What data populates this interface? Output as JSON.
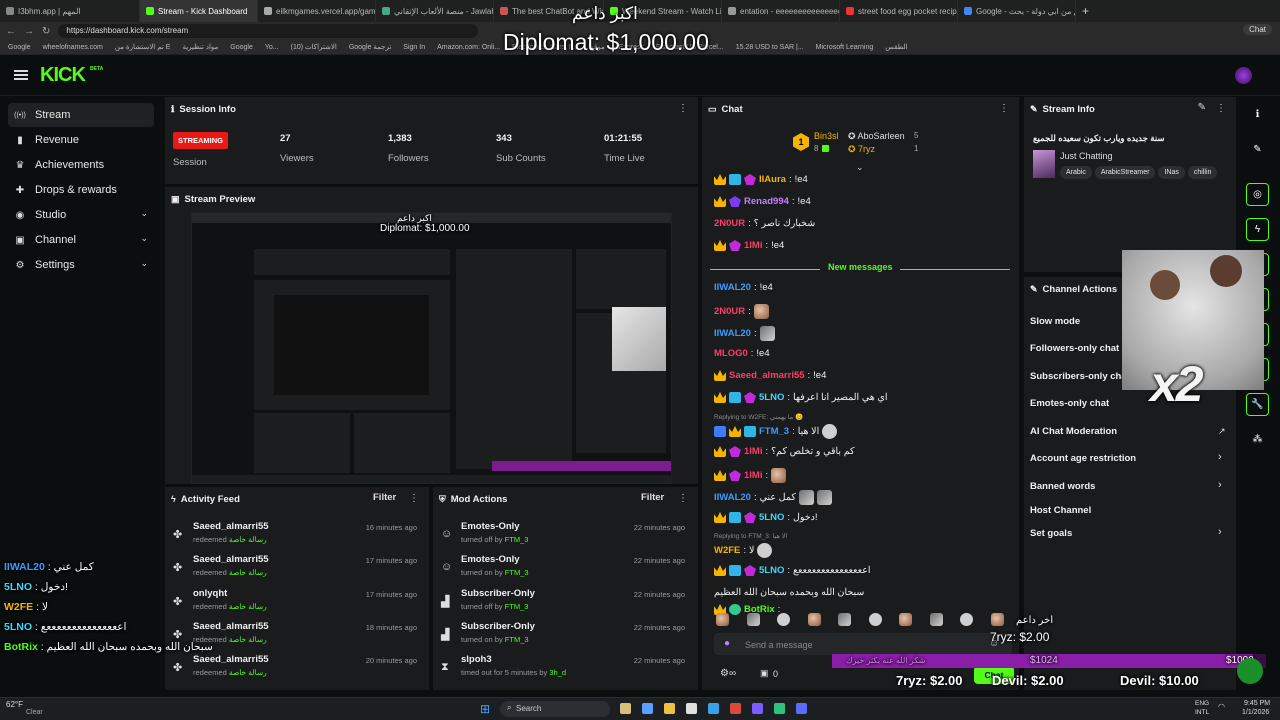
{
  "browser": {
    "tabs": [
      "I3bhm.app | المهم",
      "Stream - Kick Dashboard",
      "eilkmgames.vercel.app/games/wh",
      "منصة الألعاب الإتقاني - Jawlah | جولة",
      "The best ChatBot and Widgets fo",
      "Weekend Stream - Watch Live",
      "entation - eeeeeeeeeeeeeeeeeee",
      "street food egg pocket recipe بيض",
      "Google - المطبق من ابي دولة - بحث"
    ],
    "active_tab": 1,
    "url": "https://dashboard.kick.com/stream",
    "bookmarks": [
      "Google",
      "wheelofnames.com",
      "تم الاستشارة من E",
      "مواد تنظيرية",
      "Google",
      "Yo...",
      "(10) الاشتراكات",
      "Google ترجمة",
      "Sign In",
      "Amazon.com: Onli...",
      "Electronics, Cars, F...",
      "موقع - AliExpress",
      "Fishofast US Parcel...",
      "15.28 USD to SAR |...",
      "Microsoft Learning",
      "الطقس"
    ],
    "chat_button": "Chat"
  },
  "app": {
    "logo": "KICK",
    "beta": "BETA"
  },
  "nav": {
    "items": [
      {
        "label": "Stream",
        "icon": "stream-icon"
      },
      {
        "label": "Revenue",
        "icon": "revenue-icon"
      },
      {
        "label": "Achievements",
        "icon": "trophy-icon"
      },
      {
        "label": "Drops & rewards",
        "icon": "gift-icon"
      },
      {
        "label": "Studio",
        "icon": "studio-icon"
      },
      {
        "label": "Channel",
        "icon": "channel-icon"
      },
      {
        "label": "Settings",
        "icon": "gear-icon"
      }
    ]
  },
  "session": {
    "title": "Session Info",
    "badge": "STREAMING",
    "session_label": "Session",
    "viewers": "27",
    "viewers_label": "Viewers",
    "followers": "1,383",
    "followers_label": "Followers",
    "subs": "343",
    "subs_label": "Sub Counts",
    "time": "01:21:55",
    "time_label": "Time Live"
  },
  "preview": {
    "title": "Stream Preview",
    "overlay_arabic": "اكبر داعم",
    "overlay_diplomat": "Diplomat: $1,000.00"
  },
  "activity": {
    "title": "Activity Feed",
    "filter": "Filter",
    "rows": [
      {
        "name": "Saeed_almarri55",
        "action": "redeemed",
        "reward": "رسالة خاصة",
        "time": "16 minutes ago"
      },
      {
        "name": "Saeed_almarri55",
        "action": "redeemed",
        "reward": "رسالة خاصة",
        "time": "17 minutes ago"
      },
      {
        "name": "onlyqht",
        "action": "redeemed",
        "reward": "رسالة خاصة",
        "time": "17 minutes ago"
      },
      {
        "name": "Saeed_almarri55",
        "action": "redeemed",
        "reward": "رسالة خاصة",
        "time": "18 minutes ago"
      },
      {
        "name": "Saeed_almarri55",
        "action": "redeemed",
        "reward": "رسالة خاصة",
        "time": "20 minutes ago"
      }
    ]
  },
  "mod": {
    "title": "Mod Actions",
    "filter": "Filter",
    "rows": [
      {
        "name": "Emotes-Only",
        "action": "turned off by",
        "by": "FTM_3",
        "time": "22 minutes ago"
      },
      {
        "name": "Emotes-Only",
        "action": "turned on by",
        "by": "FTM_3",
        "time": "22 minutes ago"
      },
      {
        "name": "Subscriber-Only",
        "action": "turned off by",
        "by": "FTM_3",
        "time": "22 minutes ago"
      },
      {
        "name": "Subscriber-Only",
        "action": "turned on by",
        "by": "FTM_3",
        "time": "22 minutes ago"
      },
      {
        "name": "slpoh3",
        "action": "timed out for 5 minutes by",
        "by": "3h_d",
        "time": "22 minutes ago"
      }
    ]
  },
  "chat": {
    "title": "Chat",
    "leaders": [
      {
        "rank": "1",
        "name": "Bin3sl",
        "count": "8"
      },
      {
        "rank": "",
        "name": "AboSarleen",
        "count": "5"
      },
      {
        "rank": "",
        "name": "7ryz",
        "count": "1"
      }
    ],
    "new_messages": "New messages",
    "messages": [
      {
        "user": "IIAura",
        "color": "#f5b400",
        "text": "!e4"
      },
      {
        "user": "Renad994",
        "color": "#c77dff",
        "text": "!e4"
      },
      {
        "user": "2N0UR",
        "color": "#ff3d6b",
        "text": "شخبارك ناصر ؟"
      },
      {
        "user": "1IMi",
        "color": "#ff3d6b",
        "text": "!e4"
      },
      {
        "user": "IIWAL20",
        "color": "#3d9bff",
        "text": "!e4"
      },
      {
        "user": "2N0UR",
        "color": "#ff3d6b",
        "text": ""
      },
      {
        "user": "IIWAL20",
        "color": "#3d9bff",
        "text": ""
      },
      {
        "user": "MLOG0",
        "color": "#ff3d6b",
        "text": "!e4"
      },
      {
        "user": "Saeed_almarri55",
        "color": "#ff3d6b",
        "text": "!e4"
      },
      {
        "user": "5LNO",
        "color": "#3dd7ff",
        "text": "اي هي المصير انا اعرفها"
      },
      {
        "user": "FTM_3",
        "color": "#3d9bff",
        "text": "الا هيا"
      },
      {
        "user": "1IMi",
        "color": "#ff3d6b",
        "text": "كم باقي و تخلص كم؟"
      },
      {
        "user": "1IMi",
        "color": "#ff3d6b",
        "text": ""
      },
      {
        "user": "IIWAL20",
        "color": "#3d9bff",
        "text": "كمل عني"
      },
      {
        "user": "5LNO",
        "color": "#3dd7ff",
        "text": "دخول!"
      },
      {
        "user": "W2FE",
        "color": "#f5b400",
        "text": "لا"
      },
      {
        "user": "5LNO",
        "color": "#3dd7ff",
        "text": "اعععععععععععععععع"
      },
      {
        "user": "",
        "color": "#f0f0f0",
        "text": "سبحان الله وبحمده سبحان الله العظيم"
      },
      {
        "user": "BotRix",
        "color": "#53fc18",
        "text": ""
      }
    ],
    "reply1": "Replying to W2FE: ما يهمني 😊",
    "reply2": "Replying to FTM_3: الا هيا",
    "placeholder": "Send a message",
    "count": "0",
    "send_label": "Chat"
  },
  "streaminfo": {
    "title": "Stream Info",
    "stream_title": "سنة جديده ويارب تكون سعيده للجميع",
    "category": "Just Chatting",
    "tags": [
      "Arabic",
      "ArabicStreamer",
      "INas",
      "chillin"
    ]
  },
  "actions": {
    "title": "Channel Actions",
    "items": [
      {
        "label": "Slow mode",
        "chev": false
      },
      {
        "label": "Followers-only chat",
        "chev": false
      },
      {
        "label": "Subscribers-only chat",
        "chev": false
      },
      {
        "label": "Emotes-only chat",
        "chev": false
      },
      {
        "label": "AI Chat Moderation",
        "chev": false
      },
      {
        "label": "Account age restriction",
        "chev": true
      },
      {
        "label": "Banned words",
        "chev": true
      },
      {
        "label": "Host Channel",
        "chev": false
      },
      {
        "label": "Set goals",
        "chev": true
      }
    ]
  },
  "overlay": {
    "top_arabic": "اكبر داعم",
    "top_diplomat": "Diplomat: $1,000.00",
    "x2": "x2",
    "bottom_arabic": "اخر داعم",
    "bottom_7ryz": "7ryz: $2.00",
    "goal_left": "$1024",
    "goal_right": "$1000",
    "goal_text": "شكر الله عنه بكثر خيرك",
    "goal_progress": 0.97,
    "donors": [
      "7ryz: $2.00",
      "Devil: $2.00",
      "Devil: $10.00"
    ],
    "left_chat": [
      {
        "user": "IIWAL20",
        "text": "كمل عني"
      },
      {
        "user": "5LNO",
        "text": "دخول!"
      },
      {
        "user": "W2FE",
        "text": "لا"
      },
      {
        "user": "5LNO",
        "text": "اعععععععععععععععع"
      },
      {
        "user": "BotRix",
        "text": "سبحان الله وبحمده سبحان الله العظيم"
      }
    ]
  },
  "taskbar": {
    "search": "Search",
    "lang1": "ENG",
    "lang2": "INTL",
    "time": "9:45 PM",
    "date": "1/1/2026",
    "weather_temp": "62°F",
    "weather_text": "Clear"
  }
}
